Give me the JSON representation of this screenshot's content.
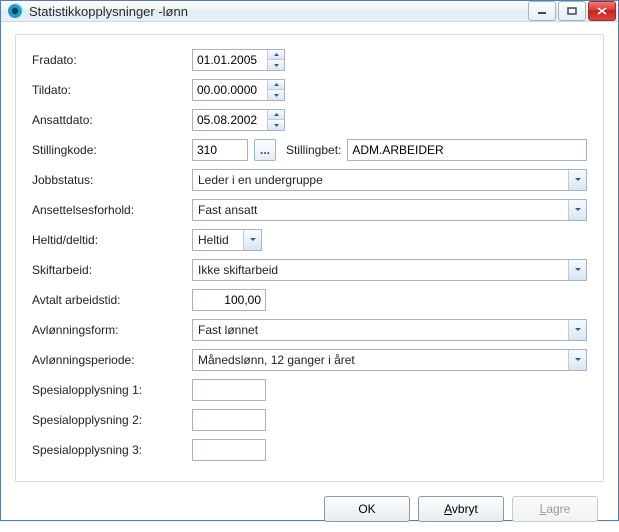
{
  "window": {
    "title": "Statistikkopplysninger -lønn",
    "minimize_tooltip": "Minimer",
    "maximize_tooltip": "Maksimer",
    "close_tooltip": "Lukk"
  },
  "labels": {
    "fradato": "Fradato:",
    "tildato": "Tildato:",
    "ansattdato": "Ansattdato:",
    "stillingkode": "Stillingkode:",
    "stillingbet": "Stillingbet:",
    "jobbstatus": "Jobbstatus:",
    "ansettelsesforhold": "Ansettelsesforhold:",
    "heltid_deltid": "Heltid/deltid:",
    "skiftarbeid": "Skiftarbeid:",
    "avtalt_arbeidstid": "Avtalt arbeidstid:",
    "avlonningsform": "Avlønningsform:",
    "avlonningsperiode": "Avlønningsperiode:",
    "spesial1": "Spesialopplysning 1:",
    "spesial2": "Spesialopplysning 2:",
    "spesial3": "Spesialopplysning 3:"
  },
  "values": {
    "fradato": "01.01.2005",
    "tildato": "00.00.0000",
    "ansattdato": "05.08.2002",
    "stillingkode": "310",
    "stillingbet": "ADM.ARBEIDER",
    "jobbstatus": "Leder i en undergruppe",
    "ansettelsesforhold": "Fast ansatt",
    "heltid_deltid": "Heltid",
    "skiftarbeid": "Ikke skiftarbeid",
    "avtalt_arbeidstid": "100,00",
    "avlonningsform": "Fast lønnet",
    "avlonningsperiode": "Månedslønn, 12 ganger i året",
    "spesial1": "",
    "spesial2": "",
    "spesial3": ""
  },
  "buttons": {
    "ok": "OK",
    "avbryt": "Avbryt",
    "lagre": "Lagre",
    "ellipsis": "..."
  }
}
